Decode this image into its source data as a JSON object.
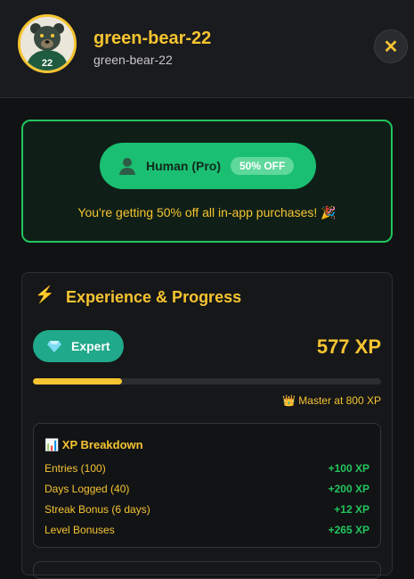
{
  "profile": {
    "username": "green-bear-22",
    "handle": "green-bear-22",
    "avatar_jersey_number": "22"
  },
  "header": {
    "close_icon": "close-icon"
  },
  "promo": {
    "plan_label": "Human (Pro)",
    "plan_badge": "50% OFF",
    "message": "You're getting 50% off all in-app purchases! 🎉",
    "accent_color": "#22c55e"
  },
  "experience": {
    "title": "Experience & Progress",
    "title_icon": "lightning-icon",
    "level_label": "Expert",
    "level_icon": "diamond-icon",
    "xp_total": "577 XP",
    "progress_fraction": 0.255,
    "next_level": "👑 Master at 800 XP",
    "breakdown": {
      "title": "📊 XP Breakdown",
      "rows": [
        {
          "label": "Entries (100)",
          "value": "+100 XP"
        },
        {
          "label": "Days Logged (40)",
          "value": "+200 XP"
        },
        {
          "label": "Streak Bonus (6 days)",
          "value": "+12 XP"
        },
        {
          "label": "Level Bonuses",
          "value": "+265 XP"
        }
      ]
    }
  },
  "colors": {
    "brand_yellow": "#f5c431",
    "success_green": "#22c55e",
    "level_teal": "#20a98a"
  }
}
